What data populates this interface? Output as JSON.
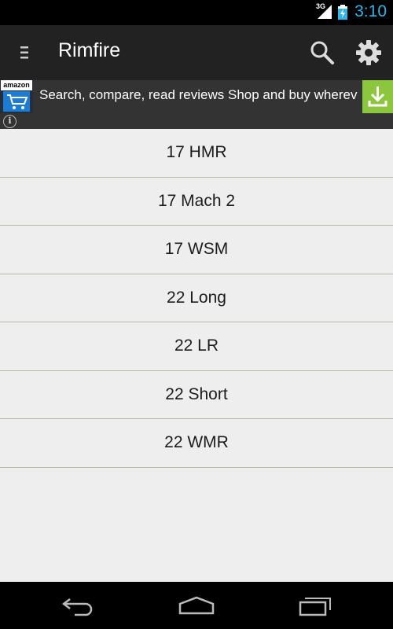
{
  "status_bar": {
    "network": "3G",
    "clock": "3:10",
    "accent_color": "#33b5e5"
  },
  "action_bar": {
    "title": "Rimfire",
    "icons": [
      "menu-icon",
      "search-icon",
      "settings-icon"
    ]
  },
  "ad": {
    "logo_text": "amazon",
    "text": "Search, compare, read reviews Shop and buy wherever",
    "info_label": "i",
    "icons": [
      "amazon-cart-icon",
      "info-icon",
      "download-icon"
    ],
    "download_color": "#8cc63f"
  },
  "list": {
    "items": [
      "17 HMR",
      "17 Mach 2",
      "17 WSM",
      "22 Long",
      "22 LR",
      "22 Short",
      "22 WMR"
    ]
  },
  "nav_bar": {
    "icons": [
      "back-icon",
      "home-icon",
      "recent-apps-icon"
    ]
  }
}
